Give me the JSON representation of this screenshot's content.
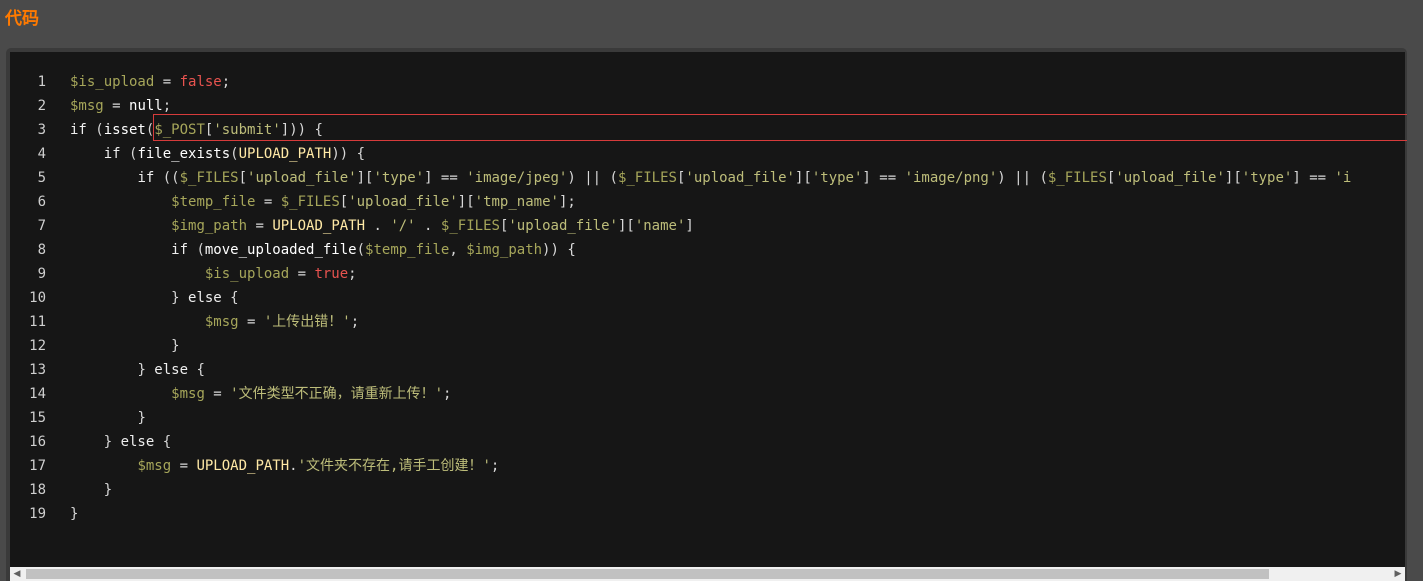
{
  "section": {
    "title": "代码"
  },
  "colors": {
    "title": "#ff7a00",
    "code_bg": "#161616",
    "variable": "#a6a65a",
    "value": "#e8534f",
    "string": "#bdbd7a",
    "highlight_border": "#d63b3b"
  },
  "code": {
    "lines": [
      {
        "num": "1",
        "indent": "",
        "tokens": [
          [
            "var",
            "$is_upload"
          ],
          [
            "pl",
            " = "
          ],
          [
            "val",
            "false"
          ],
          [
            "pl",
            ";"
          ]
        ]
      },
      {
        "num": "2",
        "indent": "",
        "tokens": [
          [
            "var",
            "$msg"
          ],
          [
            "pl",
            " = "
          ],
          [
            "fn",
            "null"
          ],
          [
            "pl",
            ";"
          ]
        ]
      },
      {
        "num": "3",
        "indent": "",
        "tokens": [
          [
            "kw",
            "if"
          ],
          [
            "pl",
            " ("
          ],
          [
            "fn",
            "isset"
          ],
          [
            "pl",
            "("
          ],
          [
            "var",
            "$_POST"
          ],
          [
            "pl",
            "["
          ],
          [
            "str",
            "'submit'"
          ],
          [
            "pl",
            "])) {"
          ]
        ]
      },
      {
        "num": "4",
        "indent": "    ",
        "tokens": [
          [
            "kw",
            "if"
          ],
          [
            "pl",
            " ("
          ],
          [
            "fn",
            "file_exists"
          ],
          [
            "pl",
            "("
          ],
          [
            "const",
            "UPLOAD_PATH"
          ],
          [
            "pl",
            ")) {"
          ]
        ]
      },
      {
        "num": "5",
        "indent": "        ",
        "tokens": [
          [
            "kw",
            "if"
          ],
          [
            "pl",
            " (("
          ],
          [
            "var",
            "$_FILES"
          ],
          [
            "pl",
            "["
          ],
          [
            "str",
            "'upload_file'"
          ],
          [
            "pl",
            "]["
          ],
          [
            "str",
            "'type'"
          ],
          [
            "pl",
            "] == "
          ],
          [
            "str",
            "'image/jpeg'"
          ],
          [
            "pl",
            ") || ("
          ],
          [
            "var",
            "$_FILES"
          ],
          [
            "pl",
            "["
          ],
          [
            "str",
            "'upload_file'"
          ],
          [
            "pl",
            "]["
          ],
          [
            "str",
            "'type'"
          ],
          [
            "pl",
            "] == "
          ],
          [
            "str",
            "'image/png'"
          ],
          [
            "pl",
            ") || ("
          ],
          [
            "var",
            "$_FILES"
          ],
          [
            "pl",
            "["
          ],
          [
            "str",
            "'upload_file'"
          ],
          [
            "pl",
            "]["
          ],
          [
            "str",
            "'type'"
          ],
          [
            "pl",
            "] == "
          ],
          [
            "str",
            "'i"
          ]
        ]
      },
      {
        "num": "6",
        "indent": "            ",
        "tokens": [
          [
            "var",
            "$temp_file"
          ],
          [
            "pl",
            " = "
          ],
          [
            "var",
            "$_FILES"
          ],
          [
            "pl",
            "["
          ],
          [
            "str",
            "'upload_file'"
          ],
          [
            "pl",
            "]["
          ],
          [
            "str",
            "'tmp_name'"
          ],
          [
            "pl",
            "];"
          ]
        ]
      },
      {
        "num": "7",
        "indent": "            ",
        "tokens": [
          [
            "var",
            "$img_path"
          ],
          [
            "pl",
            " = "
          ],
          [
            "const",
            "UPLOAD_PATH"
          ],
          [
            "pl",
            " . "
          ],
          [
            "str",
            "'/'"
          ],
          [
            "pl",
            " . "
          ],
          [
            "var",
            "$_FILES"
          ],
          [
            "pl",
            "["
          ],
          [
            "str",
            "'upload_file'"
          ],
          [
            "pl",
            "]["
          ],
          [
            "str",
            "'name'"
          ],
          [
            "pl",
            "]"
          ]
        ]
      },
      {
        "num": "8",
        "indent": "            ",
        "tokens": [
          [
            "kw",
            "if"
          ],
          [
            "pl",
            " ("
          ],
          [
            "fn",
            "move_uploaded_file"
          ],
          [
            "pl",
            "("
          ],
          [
            "var",
            "$temp_file"
          ],
          [
            "pl",
            ", "
          ],
          [
            "var",
            "$img_path"
          ],
          [
            "pl",
            ")) {"
          ]
        ]
      },
      {
        "num": "9",
        "indent": "                ",
        "tokens": [
          [
            "var",
            "$is_upload"
          ],
          [
            "pl",
            " = "
          ],
          [
            "val",
            "true"
          ],
          [
            "pl",
            ";"
          ]
        ]
      },
      {
        "num": "10",
        "indent": "            ",
        "tokens": [
          [
            "pl",
            "} "
          ],
          [
            "kw",
            "else"
          ],
          [
            "pl",
            " {"
          ]
        ]
      },
      {
        "num": "11",
        "indent": "                ",
        "tokens": [
          [
            "var",
            "$msg"
          ],
          [
            "pl",
            " = "
          ],
          [
            "str",
            "'上传出错！'"
          ],
          [
            "pl",
            ";"
          ]
        ]
      },
      {
        "num": "12",
        "indent": "            ",
        "tokens": [
          [
            "pl",
            "}"
          ]
        ]
      },
      {
        "num": "13",
        "indent": "        ",
        "tokens": [
          [
            "pl",
            "} "
          ],
          [
            "kw",
            "else"
          ],
          [
            "pl",
            " {"
          ]
        ]
      },
      {
        "num": "14",
        "indent": "            ",
        "tokens": [
          [
            "var",
            "$msg"
          ],
          [
            "pl",
            " = "
          ],
          [
            "str",
            "'文件类型不正确，请重新上传！'"
          ],
          [
            "pl",
            ";"
          ]
        ]
      },
      {
        "num": "15",
        "indent": "        ",
        "tokens": [
          [
            "pl",
            "}"
          ]
        ]
      },
      {
        "num": "16",
        "indent": "    ",
        "tokens": [
          [
            "pl",
            "} "
          ],
          [
            "kw",
            "else"
          ],
          [
            "pl",
            " {"
          ]
        ]
      },
      {
        "num": "17",
        "indent": "        ",
        "tokens": [
          [
            "var",
            "$msg"
          ],
          [
            "pl",
            " = "
          ],
          [
            "const",
            "UPLOAD_PATH"
          ],
          [
            "pl",
            "."
          ],
          [
            "str",
            "'文件夹不存在,请手工创建！'"
          ],
          [
            "pl",
            ";"
          ]
        ]
      },
      {
        "num": "18",
        "indent": "    ",
        "tokens": [
          [
            "pl",
            "}"
          ]
        ]
      },
      {
        "num": "19",
        "indent": "",
        "tokens": [
          [
            "pl",
            "}"
          ]
        ]
      }
    ]
  },
  "scrollbar": {
    "left_icon": "scroll-left-arrow-icon",
    "right_icon": "scroll-right-arrow-icon",
    "left_glyph": "◀",
    "right_glyph": "▶"
  }
}
